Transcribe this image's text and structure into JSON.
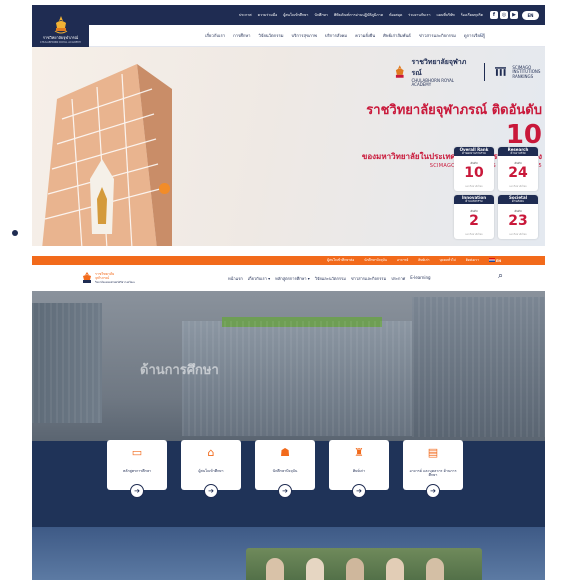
{
  "top_site": {
    "utility_links": [
      "ประกาศ",
      "ความร่วมมือ",
      "ผู้สนใจเข้าศึกษา",
      "นักศึกษา",
      "พิพิธภัณฑ์การอ่านปฏิบัติภูมิภาค",
      "ห้องสมุด",
      "ร่วมงานกับเรา",
      "แผนที่บริษัท",
      "ร้องเรียนทุจริต"
    ],
    "social_icons": [
      "facebook-icon",
      "instagram-icon",
      "youtube-icon"
    ],
    "language": "EN",
    "logo_title": "ราชวิทยาลัยจุฬาภรณ์",
    "logo_subtitle": "CHULABHORN ROYAL ACADEMY",
    "main_nav": [
      "เกี่ยวกับเรา",
      "การศึกษา",
      "วิจัยนวัตกรรม",
      "บริการสุขภาพ",
      "บริการสังคม",
      "ความยั่งยืน",
      "ศิษย์เก่าสัมพันธ์",
      "ข่าวสารและกิจกรรม",
      "ดูการเรียนรู้"
    ],
    "hero": {
      "brand": "ราชวิทยาลัยจุฬาภรณ์",
      "brand_en": "CHULABHORN ROYAL ACADEMY",
      "partner": "SCIMAGO INSTITUTIONS RANKINGS",
      "headline_1": "ราชวิทยาลัยจุฬาภรณ์ ติดอันดับ",
      "headline_rank": "10",
      "headline_2": "ของมหาวิทยาลัยในประเทศไทยจากการจัดอันดับของ",
      "headline_3": "SCIMAGO INSTITUTIONS RANKINGS 2025",
      "cards": [
        {
          "title": "Overall Rank",
          "sub": "ด้านผลงานภาพรวม",
          "label": "อันดับ",
          "value": "10",
          "note": "มหาวิทยาลัยไทย"
        },
        {
          "title": "Research",
          "sub": "ด้านงานวิจัย",
          "label": "อันดับ",
          "value": "24",
          "note": "มหาวิทยาลัยไทย"
        },
        {
          "title": "Innovation",
          "sub": "ด้านนวัตกรรม",
          "label": "อันดับ",
          "value": "2",
          "note": "มหาวิทยาลัยไทย"
        },
        {
          "title": "Societal",
          "sub": "ด้านสังคม",
          "label": "อันดับ",
          "value": "23",
          "note": "มหาวิทยาลัยไทย"
        }
      ]
    }
  },
  "second_site": {
    "orange_links": [
      "ผู้สนใจเข้าศึกษาต่อ",
      "นักศึกษาปัจจุบัน",
      "อาจารย์",
      "ศิษย์เก่า",
      "บุคคลทั่วไป",
      "ติดต่อเรา"
    ],
    "language": "EN",
    "logo_lines": [
      "ราชวิทยาลัย",
      "จุฬาภรณ์",
      "วิทยาลัยแพทยศาสตร์ศรีสวางควัฒน"
    ],
    "nav": [
      "หน้าแรก",
      "เกี่ยวกับเรา ▾",
      "หลักสูตรการศึกษา ▾",
      "วิจัยและนวัตกรรม",
      "ข่าวสารและกิจกรรม",
      "ประกาศ",
      "E-learning"
    ],
    "hero_title": "ด้านการศึกษา",
    "quick_cards": [
      {
        "label": "หลักสูตรการศึกษา",
        "icon": "monitor-icon"
      },
      {
        "label": "ผู้สนใจเข้าศึกษา",
        "icon": "graduate-person-icon"
      },
      {
        "label": "นักศึกษาปัจจุบัน",
        "icon": "students-icon"
      },
      {
        "label": "ศิษย์เก่า",
        "icon": "alumni-icon"
      },
      {
        "label": "อาจารย์ และบุคลากร ด้านการศึกษา",
        "icon": "teacher-board-icon"
      }
    ],
    "arrow": "➔"
  },
  "colors": {
    "navy": "#1f2c52",
    "orange": "#f26a1b",
    "red": "#c9183a"
  }
}
